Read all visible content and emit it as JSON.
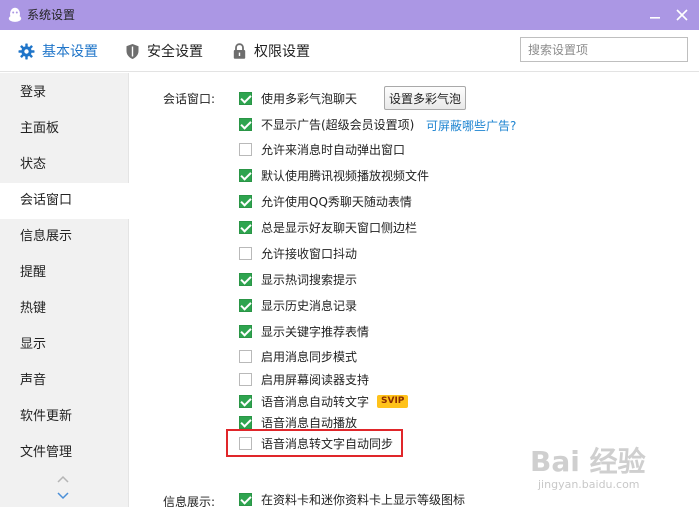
{
  "window": {
    "title": "系统设置",
    "titlebar_color": "#ab97e4"
  },
  "toolbar": {
    "tabs": [
      {
        "label": "基本设置",
        "icon": "gear-icon",
        "active": true
      },
      {
        "label": "安全设置",
        "icon": "shield-icon",
        "active": false
      },
      {
        "label": "权限设置",
        "icon": "lock-icon",
        "active": false
      }
    ],
    "search_placeholder": "搜索设置项",
    "accent_color": "#1f75c9"
  },
  "sidebar": {
    "items": [
      {
        "label": "登录"
      },
      {
        "label": "主面板"
      },
      {
        "label": "状态"
      },
      {
        "label": "会话窗口",
        "active": true
      },
      {
        "label": "信息展示"
      },
      {
        "label": "提醒"
      },
      {
        "label": "热键"
      },
      {
        "label": "显示"
      },
      {
        "label": "声音"
      },
      {
        "label": "软件更新"
      },
      {
        "label": "文件管理"
      }
    ]
  },
  "content": {
    "session_section_label": "会话窗口:",
    "bubble_button_label": "设置多彩气泡",
    "ad_link_label": "可屏蔽哪些广告?",
    "vip_badge": "SVIP",
    "options": [
      {
        "label": "使用多彩气泡聊天",
        "checked": true
      },
      {
        "label": "不显示广告(超级会员设置项)",
        "checked": true
      },
      {
        "label": "允许来消息时自动弹出窗口",
        "checked": false
      },
      {
        "label": "默认使用腾讯视频播放视频文件",
        "checked": true
      },
      {
        "label": "允许使用QQ秀聊天随动表情",
        "checked": true
      },
      {
        "label": "总是显示好友聊天窗口侧边栏",
        "checked": true
      },
      {
        "label": "允许接收窗口抖动",
        "checked": false
      },
      {
        "label": "显示热词搜索提示",
        "checked": true
      },
      {
        "label": "显示历史消息记录",
        "checked": true
      },
      {
        "label": "显示关键字推荐表情",
        "checked": true
      },
      {
        "label": "启用消息同步模式",
        "checked": false
      },
      {
        "label": "启用屏幕阅读器支持",
        "checked": false
      },
      {
        "label": "语音消息自动转文字",
        "checked": true
      },
      {
        "label": "语音消息自动播放",
        "checked": true
      },
      {
        "label": "语音消息转文字自动同步",
        "checked": false
      }
    ],
    "info_section_label": "信息展示:",
    "info_option": {
      "label": "在资料卡和迷你资料卡上显示等级图标",
      "checked": true
    },
    "checkbox_color": "#2ea44f",
    "highlight_color": "#e0262a"
  },
  "watermark": {
    "main": "Bai 经验",
    "sub": "jingyan.baidu.com"
  }
}
